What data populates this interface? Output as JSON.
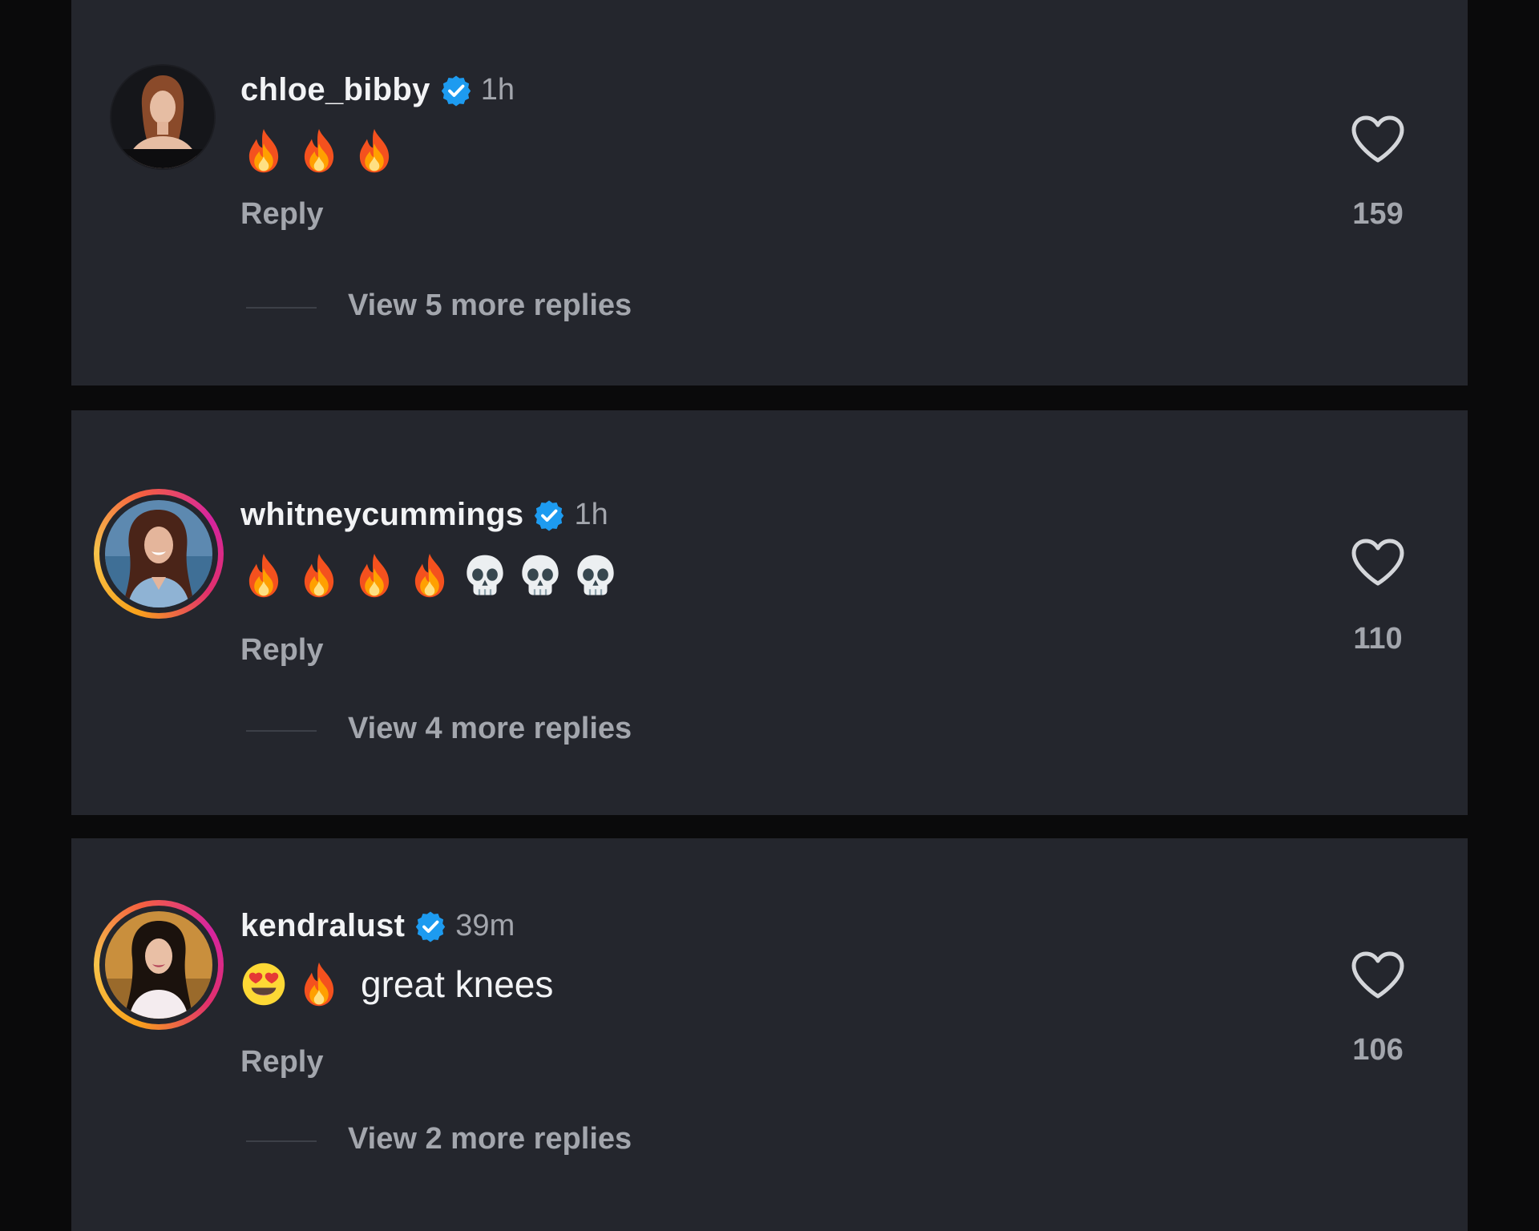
{
  "comments": [
    {
      "username": "chloe_bibby",
      "time": "1h",
      "verified": true,
      "story_ring": false,
      "emojis": [
        "fire-emoji",
        "fire-emoji",
        "fire-emoji"
      ],
      "text": "",
      "reply_label": "Reply",
      "likes": "159",
      "view_replies": "View 5 more replies"
    },
    {
      "username": "whitneycummings",
      "time": "1h",
      "verified": true,
      "story_ring": true,
      "emojis": [
        "fire-emoji",
        "fire-emoji",
        "fire-emoji",
        "fire-emoji",
        "skull-emoji",
        "skull-emoji",
        "skull-emoji"
      ],
      "text": "",
      "reply_label": "Reply",
      "likes": "110",
      "view_replies": "View 4 more replies"
    },
    {
      "username": "kendralust",
      "time": "39m",
      "verified": true,
      "story_ring": true,
      "emojis": [
        "heart-eyes-emoji",
        "fire-emoji"
      ],
      "text": "great knees",
      "reply_label": "Reply",
      "likes": "106",
      "view_replies": "View 2 more replies"
    }
  ],
  "colors": {
    "card_background": "#24262d",
    "page_background": "#0a0a0b",
    "username": "#f2f3f5",
    "secondary_text": "#a3a6ad",
    "verified_badge": "#1d9bf0",
    "story_ring": [
      "#f9a21b",
      "#f56040",
      "#d6249f"
    ]
  },
  "icons": [
    "verified-badge-icon",
    "heart-outline-icon"
  ]
}
